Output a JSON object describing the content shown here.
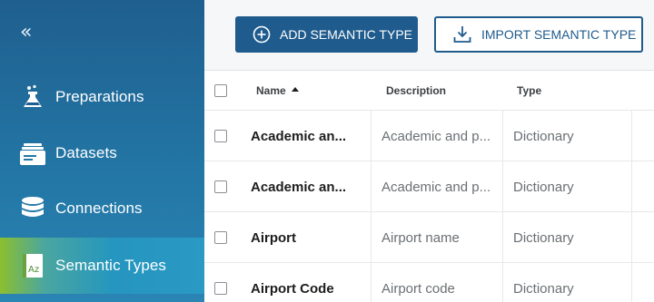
{
  "sidebar": {
    "collapse_glyph": "«",
    "items": [
      {
        "label": "Preparations",
        "icon": "flask-icon",
        "active": false
      },
      {
        "label": "Datasets",
        "icon": "datasets-icon",
        "active": false
      },
      {
        "label": "Connections",
        "icon": "database-icon",
        "active": false
      },
      {
        "label": "Semantic Types",
        "icon": "semantic-type-icon",
        "active": true
      }
    ]
  },
  "toolbar": {
    "add_label": "ADD SEMANTIC TYPE",
    "import_label": "IMPORT SEMANTIC TYPE"
  },
  "table": {
    "columns": {
      "name": "Name",
      "description": "Description",
      "type": "Type"
    },
    "rows": [
      {
        "name": "Academic an...",
        "description": "Academic and p...",
        "type": "Dictionary"
      },
      {
        "name": "Academic an...",
        "description": "Academic and p...",
        "type": "Dictionary"
      },
      {
        "name": "Airport",
        "description": "Airport name",
        "type": "Dictionary"
      },
      {
        "name": "Airport Code",
        "description": "Airport code",
        "type": "Dictionary"
      }
    ]
  },
  "colors": {
    "primary": "#1f5b8d",
    "sidebar": "#2377a6",
    "active_accent": "#8cbf2f"
  }
}
